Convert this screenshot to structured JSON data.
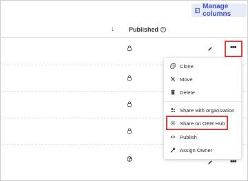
{
  "toolbar": {
    "manage_columns_label": "Manage columns"
  },
  "table": {
    "published_header": "Published",
    "rows": [
      {
        "status": "private"
      },
      {
        "status": "private"
      },
      {
        "status": "private"
      },
      {
        "status": "private"
      },
      {
        "status": "public"
      }
    ]
  },
  "menu": {
    "items": [
      {
        "label": "Clone",
        "icon": "clone-icon"
      },
      {
        "label": "Move",
        "icon": "move-icon"
      },
      {
        "label": "Delete",
        "icon": "trash-icon"
      },
      {
        "label": "Share with organization",
        "icon": "people-icon"
      },
      {
        "label": "Share on OER Hub",
        "icon": "hub-icon"
      },
      {
        "label": "Publish",
        "icon": "eye-icon"
      },
      {
        "label": "Assign Owner",
        "icon": "key-icon"
      }
    ]
  },
  "colors": {
    "accent": "#3d55c7",
    "highlight": "#e53b3b",
    "manage_bg": "#e6ebf7"
  }
}
